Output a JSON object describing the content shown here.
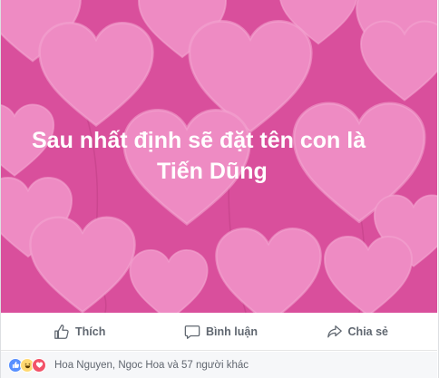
{
  "post": {
    "status_text_line1": "Sau nhất định sẽ đặt tên con là",
    "status_text_line2": "Tiến Dũng",
    "background_color": "#d94f9c",
    "heart_color": "#ee8bc3"
  },
  "actions": {
    "like_label": "Thích",
    "comment_label": "Bình luận",
    "share_label": "Chia sẻ"
  },
  "reactions": {
    "icons": [
      "like-icon",
      "haha-icon",
      "love-icon"
    ],
    "summary": "Hoa Nguyen, Ngoc Hoa và 57 người khác"
  }
}
